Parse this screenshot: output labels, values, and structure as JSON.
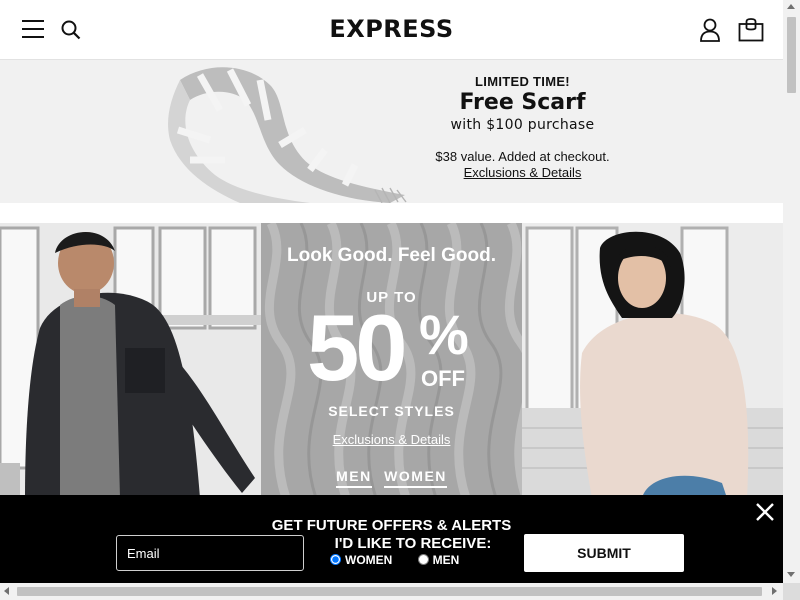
{
  "header": {
    "logo": "EXPRESS"
  },
  "icons": {
    "menu": "hamburger-icon",
    "search": "search-icon",
    "account": "user-icon",
    "bag": "shopping-bag-icon",
    "close": "close-icon"
  },
  "promo": {
    "limited": "LIMITED TIME!",
    "title": "Free Scarf",
    "subtitle": "with $100 purchase",
    "value_note": "$38 value. Added at checkout.",
    "link": "Exclusions & Details"
  },
  "hero": {
    "headline": "Look Good. Feel Good.",
    "up_to": "UP TO",
    "amount": "50",
    "percent": "%",
    "off": "OFF",
    "select": "SELECT STYLES",
    "exclusions": "Exclusions & Details",
    "men_link": "MEN",
    "women_link": "WOMEN"
  },
  "signup": {
    "title": "GET FUTURE OFFERS & ALERTS",
    "receive_label": "I'D LIKE TO RECEIVE:",
    "email_placeholder": "Email",
    "option_women": "WOMEN",
    "option_men": "MEN",
    "selected_option": "WOMEN",
    "submit": "SUBMIT"
  },
  "colors": {
    "signup_bg": "#000000",
    "promo_bg": "#f1f1f1",
    "text": "#111111"
  }
}
